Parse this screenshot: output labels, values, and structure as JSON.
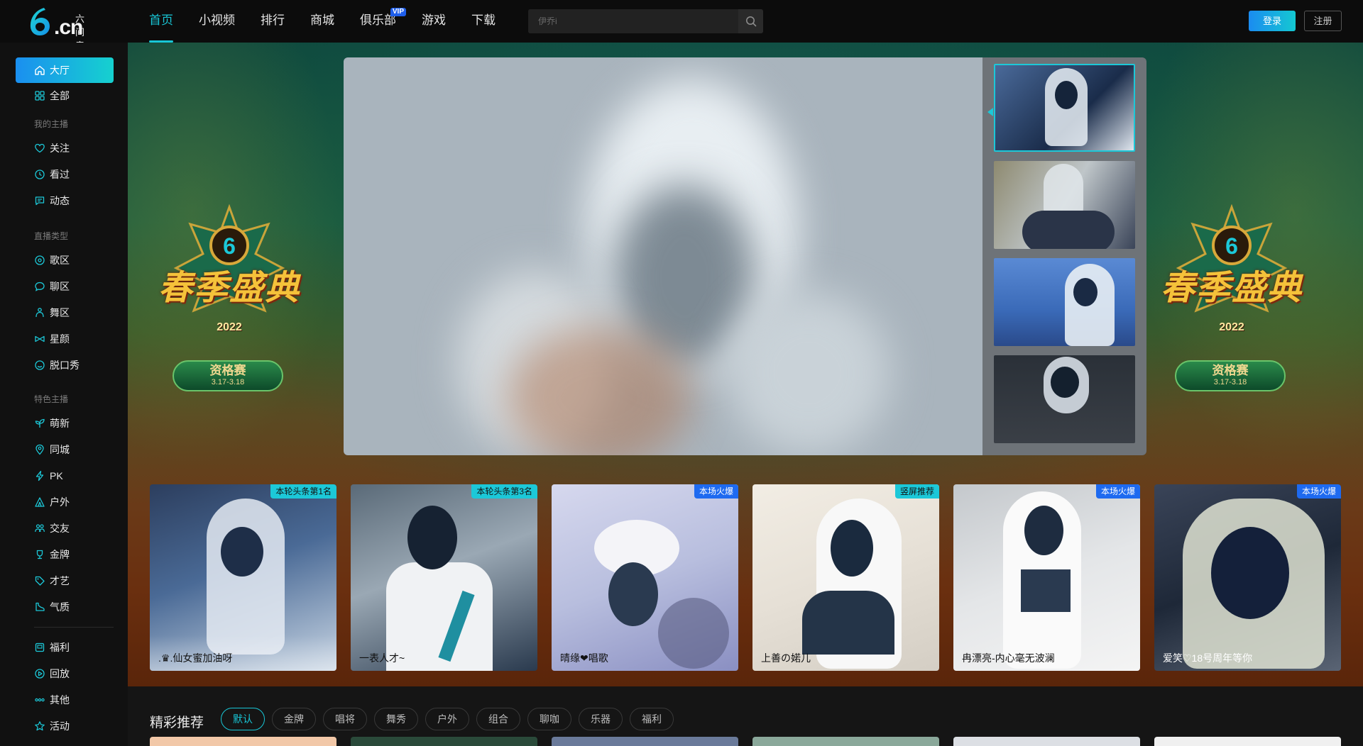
{
  "brand": {
    "cn": "六间房",
    "domain": ".cn"
  },
  "nav": {
    "items": [
      {
        "label": "首页",
        "active": true
      },
      {
        "label": "小视频"
      },
      {
        "label": "排行"
      },
      {
        "label": "商城"
      },
      {
        "label": "俱乐部",
        "badge": "VIP"
      },
      {
        "label": "游戏"
      },
      {
        "label": "下载"
      }
    ]
  },
  "search": {
    "placeholder": "伊乔i"
  },
  "auth": {
    "login": "登录",
    "register": "注册"
  },
  "sidebar": {
    "hall": "大厅",
    "all": "全部",
    "group_my": "我的主播",
    "follow": "关注",
    "watched": "看过",
    "dynamic": "动态",
    "group_type": "直播类型",
    "song": "歌区",
    "chat": "聊区",
    "dance": "舞区",
    "looks": "星颜",
    "talkshow": "脱口秀",
    "group_feature": "特色主播",
    "newbie": "萌新",
    "samecity": "同城",
    "pk": "PK",
    "outdoor": "户外",
    "social": "交友",
    "gold": "金牌",
    "talent": "才艺",
    "temperament": "气质",
    "welfare": "福利",
    "replay": "回放",
    "other": "其他",
    "activity": "活动"
  },
  "banner": {
    "event_title": "春季盛典",
    "event_year": "2022",
    "event_stage": "资格赛",
    "event_dates": "3.17-3.18"
  },
  "cards": [
    {
      "tag": "本轮头条第1名",
      "name": ".♛.仙女蜜加油呀",
      "tag_color": "#1cc8d8"
    },
    {
      "tag": "本轮头条第3名",
      "name": "一表人才~",
      "tag_color": "#1cc8d8"
    },
    {
      "tag": "本场火爆",
      "name": "晴缘❤唱歌",
      "tag_color": "#1e6af0"
    },
    {
      "tag": "竖屏推荐",
      "name": "上善の婼儿",
      "tag_color": "#1cc8d8"
    },
    {
      "tag": "本场火爆",
      "name": "冉漂亮-内心毫无波澜",
      "tag_color": "#1e6af0"
    },
    {
      "tag": "本场火爆",
      "name": "爱笑♡18号周年等你",
      "tag_color": "#1e6af0"
    }
  ],
  "recommend": {
    "title": "精彩推荐",
    "chips": [
      "默认",
      "金牌",
      "唱将",
      "舞秀",
      "户外",
      "组合",
      "聊咖",
      "乐器",
      "福利"
    ]
  },
  "colors": {
    "accent": "#18c6d6",
    "login_gradient": [
      "#1b8cf0",
      "#14c8d2"
    ],
    "vip": "#1e5eea"
  }
}
